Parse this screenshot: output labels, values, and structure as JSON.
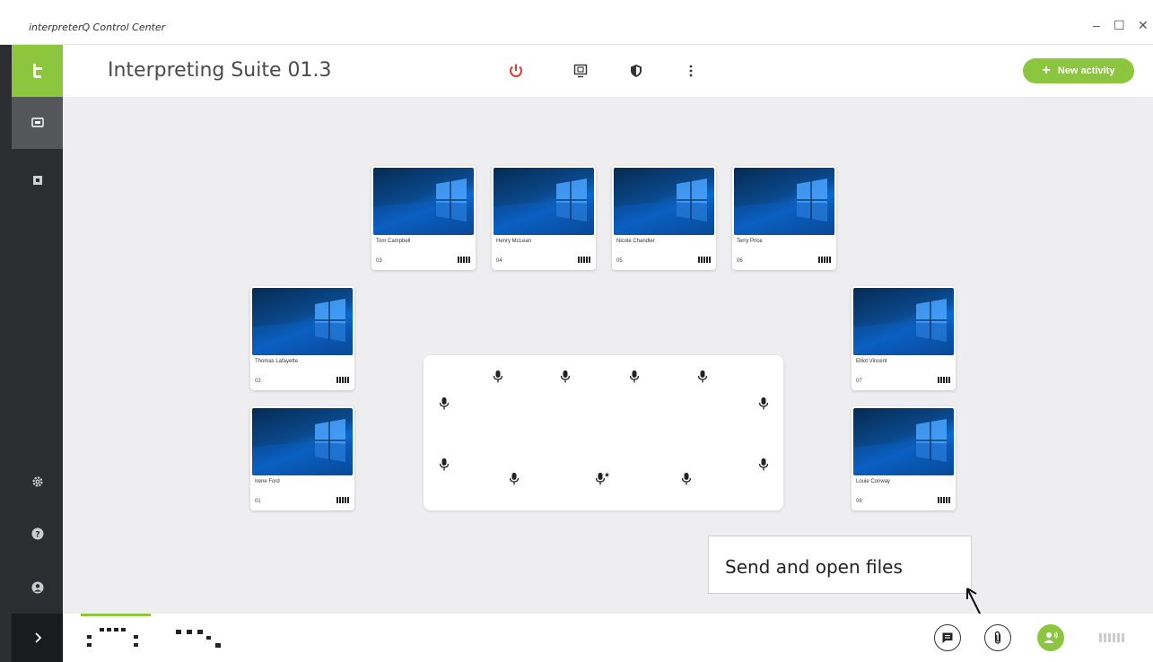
{
  "window": {
    "title": "interpreterQ Control Center",
    "minimize": "–",
    "maximize": "☐",
    "close": "✕"
  },
  "header": {
    "suite_title": "Interpreting Suite 01.3",
    "new_activity_label": "New activity",
    "new_activity_plus": "+"
  },
  "colors": {
    "accent": "#8cc63f",
    "power": "#e53935",
    "sidebar": "#2b2d30",
    "main_bg": "#eeeef0"
  },
  "booths": [
    {
      "name": "Tom Campbell",
      "num": "03"
    },
    {
      "name": "Henry McLean",
      "num": "04"
    },
    {
      "name": "Nicole Chandler",
      "num": "05"
    },
    {
      "name": "Terry Price",
      "num": "06"
    },
    {
      "name": "Thomas Lafayette",
      "num": "02"
    },
    {
      "name": "Irene Ford",
      "num": "01"
    },
    {
      "name": "Elliot Vincent",
      "num": "07"
    },
    {
      "name": "Louie Conway",
      "num": "08"
    }
  ],
  "callout": {
    "text": "Send and open files"
  },
  "icons": {
    "logo": "app-logo-icon",
    "sidebar": [
      "monitor-icon",
      "square-icon",
      "gear-icon",
      "help-icon",
      "user-icon",
      "chevron-right-icon"
    ],
    "header": [
      "power-icon",
      "screen-share-icon",
      "shield-icon",
      "more-vertical-icon"
    ],
    "footer": [
      "chat-icon",
      "paperclip-icon",
      "listener-icon"
    ]
  }
}
